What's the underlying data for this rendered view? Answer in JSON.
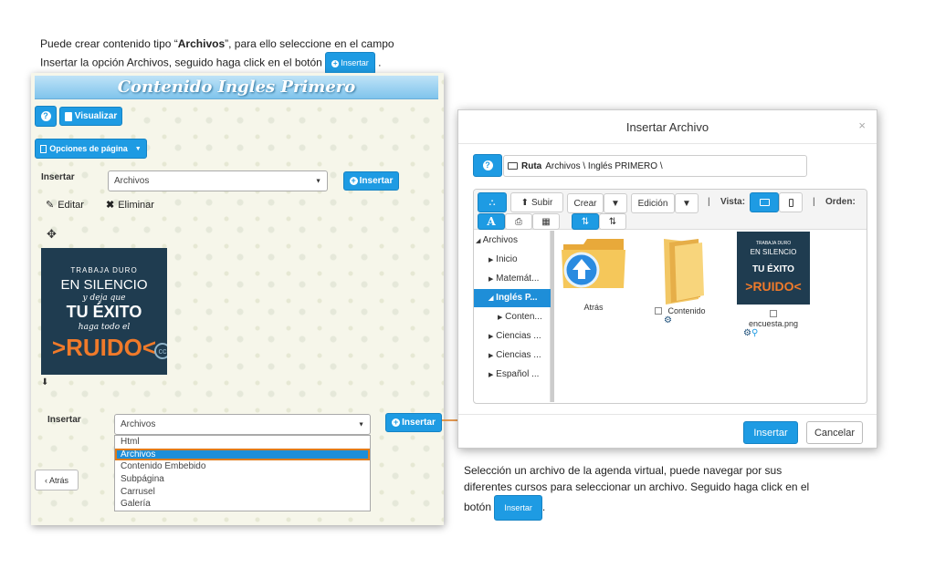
{
  "instructions_top": {
    "line1_pre": "Puede crear contenido tipo “",
    "line1_bold": "Archivos",
    "line1_post": "”, para ello seleccione en el campo",
    "line2": "Insertar la opción Archivos, seguido haga click en el botón",
    "button_label": "Insertar",
    "end": "."
  },
  "instructions_bottom": {
    "line1": "Selección un archivo de la agenda virtual, puede navegar por sus",
    "line2": "diferentes cursos para seleccionar un archivo. Seguido haga click en el",
    "line3_pre": "botón",
    "button_label": "Insertar",
    "end": "."
  },
  "left_panel": {
    "title": "Contenido Ingles Primero",
    "help_label": "?",
    "visualizar_label": "Visualizar",
    "opciones_label": "Opciones de página",
    "insertar_label_1": "Insertar",
    "select_value_1": "Archivos",
    "insert_button_1": "Insertar",
    "editar_label": "Editar",
    "eliminar_label": "Eliminar",
    "poster": {
      "line1": "TRABAJA DURO",
      "line2": "EN SILENCIO",
      "line3": "y deja que",
      "line4": "TU ÉXITO",
      "line5": "haga todo el",
      "line6": ">RUIDO<",
      "corner": "cc"
    },
    "insertar_label_2": "Insertar",
    "select_value_2": "Archivos",
    "insert_button_2": "Insertar",
    "dropdown_options": [
      "Html",
      "Archivos",
      "Contenido Embebido",
      "Subpágina",
      "Carrusel",
      "Galería"
    ],
    "selected_option": "Archivos",
    "back_label": "Atrás"
  },
  "modal": {
    "title": "Insertar Archivo",
    "close": "×",
    "path_label": "Ruta",
    "path_value": "Archivos \\ Inglés PRIMERO \\",
    "toolbar": {
      "subir": "Subir",
      "crear": "Crear",
      "edicion": "Edición",
      "sep": "|",
      "vista": "Vista:",
      "orden": "Orden:",
      "font_a": "A"
    },
    "tree": [
      "Archivos",
      "Inicio",
      "Matemát...",
      "Inglés P...",
      "Conten...",
      "Ciencias ...",
      "Ciencias ...",
      "Español ..."
    ],
    "files": [
      {
        "name": "Atrás"
      },
      {
        "name": "Contenido"
      },
      {
        "name": "encuesta.png"
      }
    ],
    "insert_button": "Insertar",
    "cancel_button": "Cancelar"
  },
  "colors": {
    "accent": "#1e9be3",
    "highlight_outline": "#e07b1a",
    "poster_bg": "#1f3c50",
    "poster_accent": "#f07a2a"
  }
}
